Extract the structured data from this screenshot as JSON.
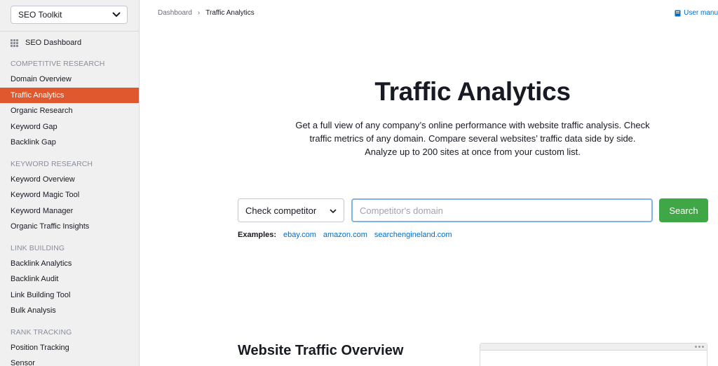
{
  "sidebar": {
    "toolkit_select": "SEO Toolkit",
    "dashboard_label": "SEO Dashboard",
    "sections": [
      {
        "title": "COMPETITIVE RESEARCH",
        "items": [
          "Domain Overview",
          "Traffic Analytics",
          "Organic Research",
          "Keyword Gap",
          "Backlink Gap"
        ]
      },
      {
        "title": "KEYWORD RESEARCH",
        "items": [
          "Keyword Overview",
          "Keyword Magic Tool",
          "Keyword Manager",
          "Organic Traffic Insights"
        ]
      },
      {
        "title": "LINK BUILDING",
        "items": [
          "Backlink Analytics",
          "Backlink Audit",
          "Link Building Tool",
          "Bulk Analysis"
        ]
      },
      {
        "title": "RANK TRACKING",
        "items": [
          "Position Tracking",
          "Sensor"
        ]
      }
    ],
    "active_item": "Traffic Analytics"
  },
  "breadcrumb": {
    "root": "Dashboard",
    "current": "Traffic Analytics"
  },
  "header": {
    "user_manual": "User manu"
  },
  "hero": {
    "title": "Traffic Analytics",
    "description": "Get a full view of any company’s online performance with website traffic analysis. Check traffic metrics of any domain. Compare several websites’ traffic data side by side. Analyze up to 200 sites at once from your custom list."
  },
  "search": {
    "mode_select": "Check competitor",
    "placeholder": "Competitor's domain",
    "value": "",
    "button": "Search"
  },
  "examples": {
    "label": "Examples:",
    "links": [
      "ebay.com",
      "amazon.com",
      "searchengineland.com"
    ]
  },
  "overview": {
    "title": "Website Traffic Overview"
  },
  "colors": {
    "accent_active": "#e0582d",
    "search_button": "#3fa745",
    "link": "#006dca",
    "input_focus_border": "#7fb2e8"
  }
}
